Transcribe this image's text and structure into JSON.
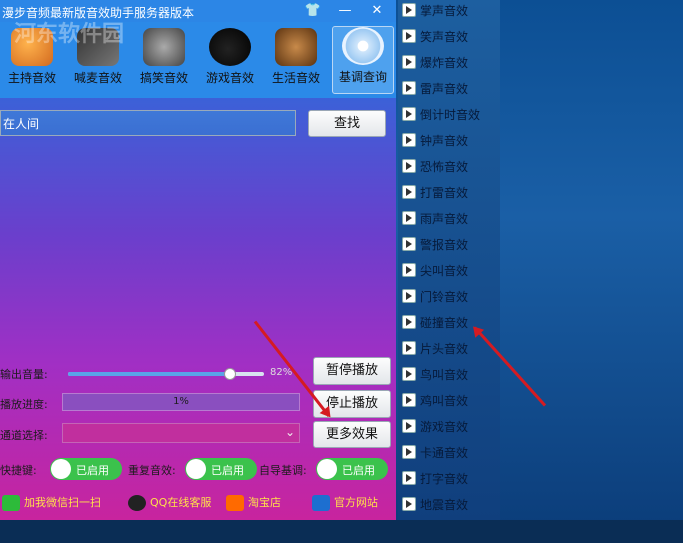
{
  "window": {
    "title": "漫步音频最新版音效助手服务器版本",
    "buttons": {
      "skin": "👕",
      "minimize": "—",
      "close": "✕"
    }
  },
  "toolbar": {
    "tools": [
      {
        "label": "主持音效",
        "icon": "host-audio-icon"
      },
      {
        "label": "喊麦音效",
        "icon": "film-reel-icon"
      },
      {
        "label": "搞笑音效",
        "icon": "microphone-icon"
      },
      {
        "label": "游戏音效",
        "icon": "bomb-icon"
      },
      {
        "label": "生活音效",
        "icon": "character-icon"
      },
      {
        "label": "基调查询",
        "icon": "disc-icon"
      }
    ]
  },
  "watermark": "河东软件园",
  "search": {
    "value": "在人间",
    "button": "查找"
  },
  "controls": {
    "volume_label": "输出音量:",
    "volume_value": "82%",
    "volume_fraction": 0.82,
    "progress_label": "播放进度:",
    "progress_value": "1%",
    "channel_label": "通道选择:",
    "channel_value": "",
    "pause": "暂停播放",
    "stop": "停止播放",
    "more": "更多效果"
  },
  "toggles": [
    {
      "label": "快捷键:",
      "state": "已启用"
    },
    {
      "label": "重复音效:",
      "state": "已启用"
    },
    {
      "label": "自导基调:",
      "state": "已启用"
    }
  ],
  "links": [
    {
      "label": "加我微信扫一扫",
      "icon": "wechat-icon"
    },
    {
      "label": "QQ在线客服",
      "icon": "qq-icon"
    },
    {
      "label": "淘宝店",
      "icon": "taobao-icon"
    },
    {
      "label": "官方网站",
      "icon": "home-icon"
    }
  ],
  "effects_list": [
    "掌声音效",
    "笑声音效",
    "爆炸音效",
    "雷声音效",
    "倒计时音效",
    "钟声音效",
    "恐怖音效",
    "打雷音效",
    "雨声音效",
    "警报音效",
    "尖叫音效",
    "门铃音效",
    "碰撞音效",
    "片头音效",
    "鸟叫音效",
    "鸡叫音效",
    "游戏音效",
    "卡通音效",
    "打字音效",
    "地震音效"
  ],
  "colors": {
    "accent": "#2b8ae8",
    "toggle_on": "#3bc24c",
    "link": "#ffe14a",
    "arrow": "#d51b22"
  }
}
